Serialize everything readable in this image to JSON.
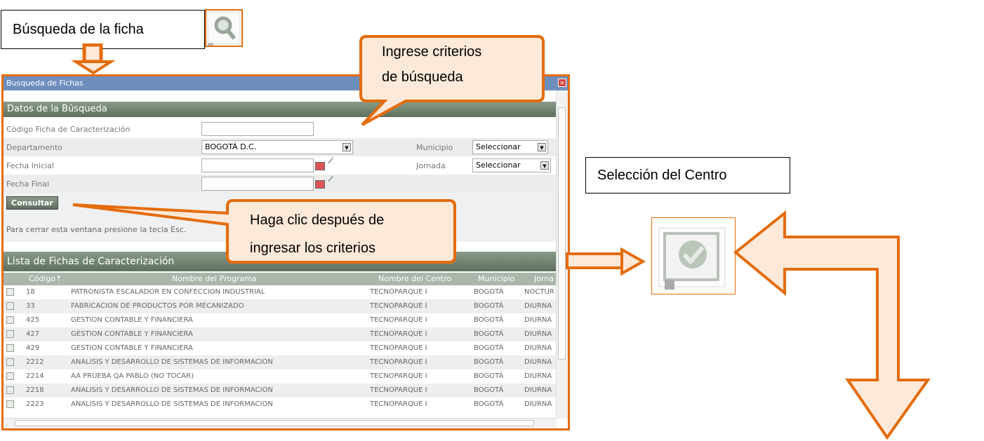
{
  "annotations": {
    "search_label": "Búsqueda de la ficha",
    "select_center_label": "Selección del Centro",
    "callout_criteria_line1": "Ingrese criterios",
    "callout_criteria_line2": "de búsqueda",
    "callout_click_line1": "Haga clic después de",
    "callout_click_line2": "ingresar los criterios"
  },
  "window": {
    "title": "Busqueda de Fichas",
    "close_glyph": "×"
  },
  "search_section": {
    "title": "Datos de la Búsqueda",
    "code_label": "Código Ficha de Caracterización",
    "code_value": "",
    "department_label": "Departamento",
    "department_value": "BOGOTÁ D.C.",
    "municipality_label": "Municipio",
    "municipality_value": "Seleccionar",
    "start_date_label": "Fecha Inicial",
    "start_date_value": "",
    "shift_label": "Jornada",
    "shift_value": "Seleccionar",
    "end_date_label": "Fecha Final",
    "end_date_value": "",
    "consult_button": "Consultar",
    "close_hint": "Para cerrar esta ventana presione la tecla Esc."
  },
  "list_section": {
    "title": "Lista de Fichas de Caracterización",
    "columns": [
      "Código↑",
      "Nombre del Programa",
      "Nombre del Centro",
      "Municipio",
      "Jorna"
    ],
    "rows": [
      {
        "code": "18",
        "program": "PATRONISTA ESCALADOR EN CONFECCION INDUSTRIAL",
        "center": "TECNOPARQUE I",
        "municipality": "BOGOTÁ",
        "shift": "NOCTUR"
      },
      {
        "code": "33",
        "program": "FABRICACION DE PRODUCTOS POR MECANIZADO",
        "center": "TECNOPARQUE I",
        "municipality": "BOGOTÁ",
        "shift": "DIURNA"
      },
      {
        "code": "425",
        "program": "GESTION CONTABLE Y FINANCIERA",
        "center": "TECNOPARQUE I",
        "municipality": "BOGOTÁ",
        "shift": "DIURNA"
      },
      {
        "code": "427",
        "program": "GESTION CONTABLE Y FINANCIERA",
        "center": "TECNOPARQUE I",
        "municipality": "BOGOTÁ",
        "shift": "DIURNA"
      },
      {
        "code": "429",
        "program": "GESTION CONTABLE Y FINANCIERA",
        "center": "TECNOPARQUE I",
        "municipality": "BOGOTÁ",
        "shift": "DIURNA"
      },
      {
        "code": "2212",
        "program": "ANALISIS Y DESARROLLO DE SISTEMAS DE INFORMACION",
        "center": "TECNOPARQUE I",
        "municipality": "BOGOTÁ",
        "shift": "DIURNA"
      },
      {
        "code": "2214",
        "program": "AA PRUEBA QA PABLO (NO TOCAR)",
        "center": "TECNOPARQUE I",
        "municipality": "BOGOTÁ",
        "shift": "DIURNA"
      },
      {
        "code": "2218",
        "program": "ANALISIS Y DESARROLLO DE SISTEMAS DE INFORMACION",
        "center": "TECNOPARQUE I",
        "municipality": "BOGOTÁ",
        "shift": "DIURNA"
      },
      {
        "code": "2223",
        "program": "ANALISIS Y DESARROLLO DE SISTEMAS DE INFORMACION",
        "center": "TECNOPARQUE I",
        "municipality": "BOGOTÁ",
        "shift": "DIURNA"
      }
    ]
  },
  "colors": {
    "accent": "#e46c0a",
    "callout_fill": "#fde9d9",
    "titlebar": "#6e8fbe",
    "section_header": "#6b7d6b"
  },
  "icons": {
    "search": "magnifier-icon",
    "select": "checkmark-icon"
  }
}
